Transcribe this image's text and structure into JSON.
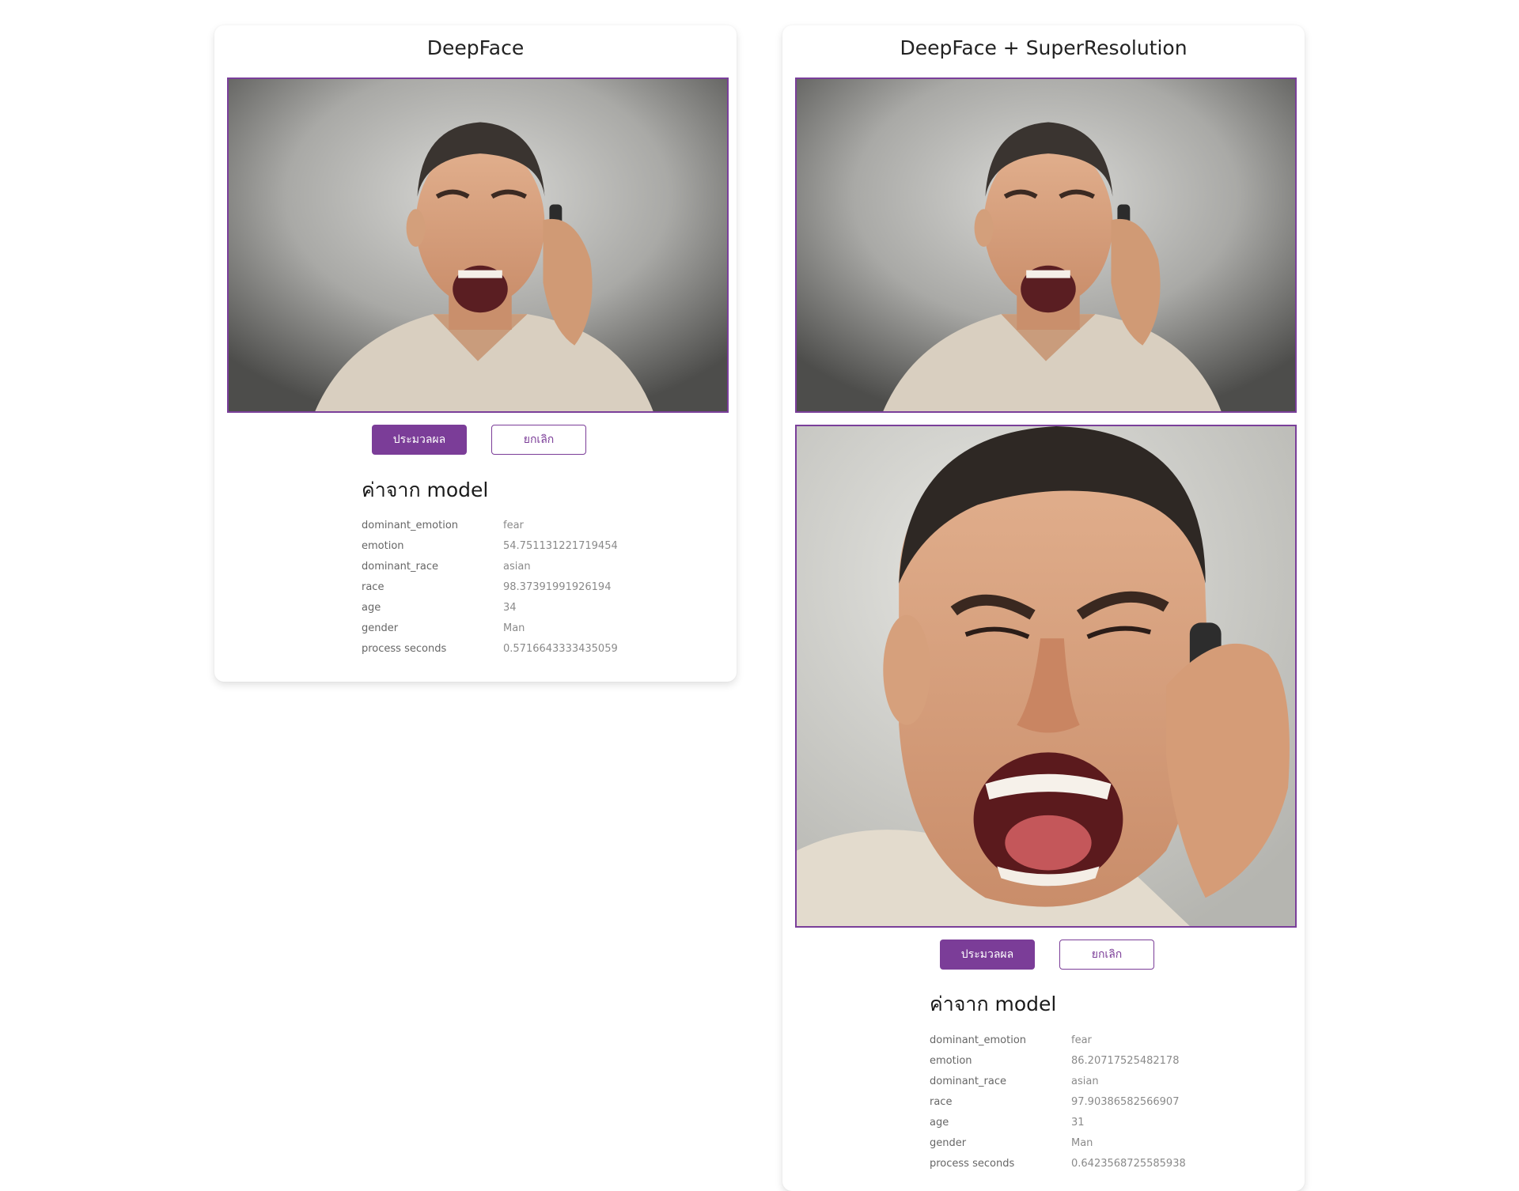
{
  "panels": [
    {
      "title": "DeepFace",
      "images": [
        {
          "name": "face-photo-original",
          "alt": "angry man on phone"
        }
      ],
      "buttons": {
        "process_label": "ประมวลผล",
        "cancel_label": "ยกเลิก"
      },
      "results": {
        "title": "ค่าจาก model",
        "rows": [
          {
            "key": "dominant_emotion",
            "value": "fear"
          },
          {
            "key": "emotion",
            "value": "54.751131221719454"
          },
          {
            "key": "dominant_race",
            "value": "asian"
          },
          {
            "key": "race",
            "value": "98.37391991926194"
          },
          {
            "key": "age",
            "value": "34"
          },
          {
            "key": "gender",
            "value": "Man"
          },
          {
            "key": "process seconds",
            "value": "0.5716643333435059"
          }
        ]
      }
    },
    {
      "title": "DeepFace + SuperResolution",
      "images": [
        {
          "name": "face-photo-original",
          "alt": "angry man on phone"
        },
        {
          "name": "face-photo-superresolution",
          "alt": "enhanced face crop"
        }
      ],
      "buttons": {
        "process_label": "ประมวลผล",
        "cancel_label": "ยกเลิก"
      },
      "results": {
        "title": "ค่าจาก model",
        "rows": [
          {
            "key": "dominant_emotion",
            "value": "fear"
          },
          {
            "key": "emotion",
            "value": "86.20717525482178"
          },
          {
            "key": "dominant_race",
            "value": "asian"
          },
          {
            "key": "race",
            "value": "97.90386582566907"
          },
          {
            "key": "age",
            "value": "31"
          },
          {
            "key": "gender",
            "value": "Man"
          },
          {
            "key": "process seconds",
            "value": "0.6423568725585938"
          }
        ]
      }
    }
  ],
  "colors": {
    "accent": "#7b3d98",
    "image_border": "#7a3f9a",
    "key_text": "#666666",
    "value_text": "#8a8a8a"
  }
}
